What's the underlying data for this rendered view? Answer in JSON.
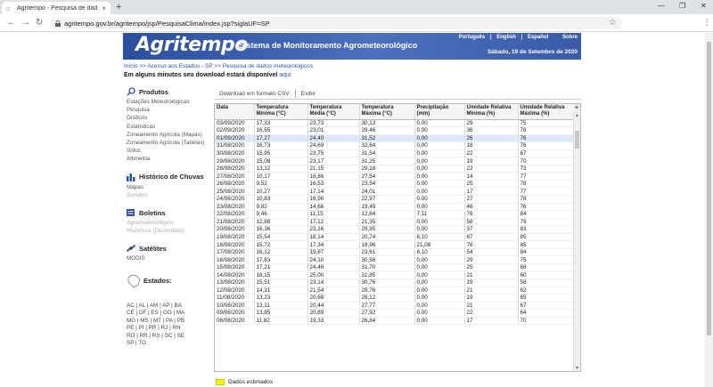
{
  "browser": {
    "tab_title": "Agritempo - Pesquisa de dad...",
    "url": "agritempo.gov.br/agritempo/jsp/PesquisaClima/index.jsp?siglaUF=SP",
    "new_tab": "+",
    "close_tab": "×"
  },
  "header": {
    "logo": "Agritempo",
    "subtitle": "Sistema de Monitoramento Agrometeorológico",
    "languages": [
      "Português",
      "English",
      "Español",
      "Sobre"
    ],
    "date": "Sábado, 19 de Setembro de 2020"
  },
  "breadcrumb": "Início >> Acesso aos Estados - SP >> Pesquisa de dados meteorológicos",
  "notice": {
    "text": "Em alguns minutos seu download estará disponível",
    "link": "aqui"
  },
  "sidebar": {
    "produtos": {
      "title": "Produtos",
      "items": [
        "Estações Meteorológicas",
        "Pesquisa",
        "Gráficos",
        "Estatísticas",
        "Zoneamento Agrícola (Mapas)",
        "Zoneamento Agrícola (Tabelas)",
        "Solos",
        "Altimetria"
      ]
    },
    "chuvas": {
      "title": "Histórico de Chuvas",
      "items": [
        "Mapas",
        "Sumário"
      ]
    },
    "boletins": {
      "title": "Boletins",
      "items": [
        "Agrometeorológico",
        "Históricos (Decendiais)"
      ]
    },
    "satelites": {
      "title": "Satélites",
      "items": [
        "MODIS"
      ]
    },
    "estados": {
      "title": "Estados:",
      "rows": [
        "AC | AL | AM | AP | BA",
        "CE | DF | ES | GO | MA",
        "MG | MS | MT | PA | PB",
        "PE | PI | PR | RJ | RN",
        "RO | RR | RS | SC | SE",
        "SP | TO"
      ]
    }
  },
  "toolbar": {
    "download": "Download em formato CSV",
    "exit": "Exibir"
  },
  "table": {
    "headers": [
      "Data",
      "Temperatura Mínima (°C)",
      "Temperatura Média (°C)",
      "Temperatura Máxima (°C)",
      "Precipitação (mm)",
      "Umidade Relativa Mínima (%)",
      "Umidade Relativa Máxima (%)"
    ],
    "rows": [
      [
        "03/09/2020",
        "17,33",
        "23,73",
        "30,13",
        "0,00",
        "29",
        "75"
      ],
      [
        "02/09/2020",
        "16,55",
        "23,01",
        "29,46",
        "0,00",
        "36",
        "78"
      ],
      [
        "01/09/2020",
        "17,27",
        "24,40",
        "31,52",
        "0,00",
        "26",
        "76"
      ],
      [
        "31/08/2020",
        "16,73",
        "24,69",
        "32,64",
        "0,00",
        "18",
        "76"
      ],
      [
        "30/08/2020",
        "15,95",
        "23,75",
        "31,54",
        "0,00",
        "22",
        "67"
      ],
      [
        "29/08/2020",
        "15,08",
        "23,17",
        "31,25",
        "0,00",
        "19",
        "70"
      ],
      [
        "28/08/2020",
        "13,12",
        "21,15",
        "29,18",
        "0,00",
        "22",
        "73"
      ],
      [
        "27/08/2020",
        "10,17",
        "18,86",
        "27,54",
        "0,00",
        "14",
        "77"
      ],
      [
        "26/08/2020",
        "9,52",
        "16,53",
        "23,54",
        "0,00",
        "25",
        "78"
      ],
      [
        "25/08/2020",
        "10,27",
        "17,14",
        "24,01",
        "0,00",
        "17",
        "77"
      ],
      [
        "24/08/2020",
        "10,83",
        "16,90",
        "22,97",
        "0,00",
        "27",
        "78"
      ],
      [
        "23/08/2020",
        "9,82",
        "14,66",
        "19,49",
        "0,00",
        "46",
        "76"
      ],
      [
        "22/08/2020",
        "9,46",
        "11,15",
        "12,84",
        "7,11",
        "76",
        "84"
      ],
      [
        "21/08/2020",
        "12,88",
        "17,12",
        "21,35",
        "0,00",
        "58",
        "79"
      ],
      [
        "20/08/2020",
        "16,36",
        "23,16",
        "29,95",
        "0,00",
        "37",
        "83"
      ],
      [
        "19/08/2020",
        "15,54",
        "18,14",
        "20,74",
        "6,10",
        "67",
        "85"
      ],
      [
        "18/08/2020",
        "15,72",
        "17,34",
        "18,96",
        "21,08",
        "78",
        "85"
      ],
      [
        "17/08/2020",
        "16,12",
        "19,87",
        "23,61",
        "6,10",
        "54",
        "84"
      ],
      [
        "16/08/2020",
        "17,63",
        "24,10",
        "30,56",
        "0,00",
        "29",
        "75"
      ],
      [
        "15/08/2020",
        "17,21",
        "24,46",
        "31,70",
        "0,00",
        "25",
        "68"
      ],
      [
        "14/08/2020",
        "18,15",
        "25,00",
        "31,85",
        "0,00",
        "21",
        "60"
      ],
      [
        "13/08/2020",
        "15,51",
        "23,14",
        "30,76",
        "0,00",
        "19",
        "58"
      ],
      [
        "12/08/2020",
        "14,31",
        "21,54",
        "28,76",
        "0,00",
        "21",
        "62"
      ],
      [
        "11/08/2020",
        "13,23",
        "20,68",
        "28,12",
        "0,00",
        "19",
        "65"
      ],
      [
        "10/08/2020",
        "13,11",
        "20,44",
        "27,77",
        "0,00",
        "21",
        "67"
      ],
      [
        "09/08/2020",
        "13,85",
        "20,89",
        "27,92",
        "0,00",
        "22",
        "64"
      ],
      [
        "08/08/2020",
        "11,82",
        "19,33",
        "26,84",
        "0,00",
        "17",
        "70"
      ]
    ]
  },
  "legend": {
    "label": "Dados estimados",
    "color": "#f6f600"
  }
}
